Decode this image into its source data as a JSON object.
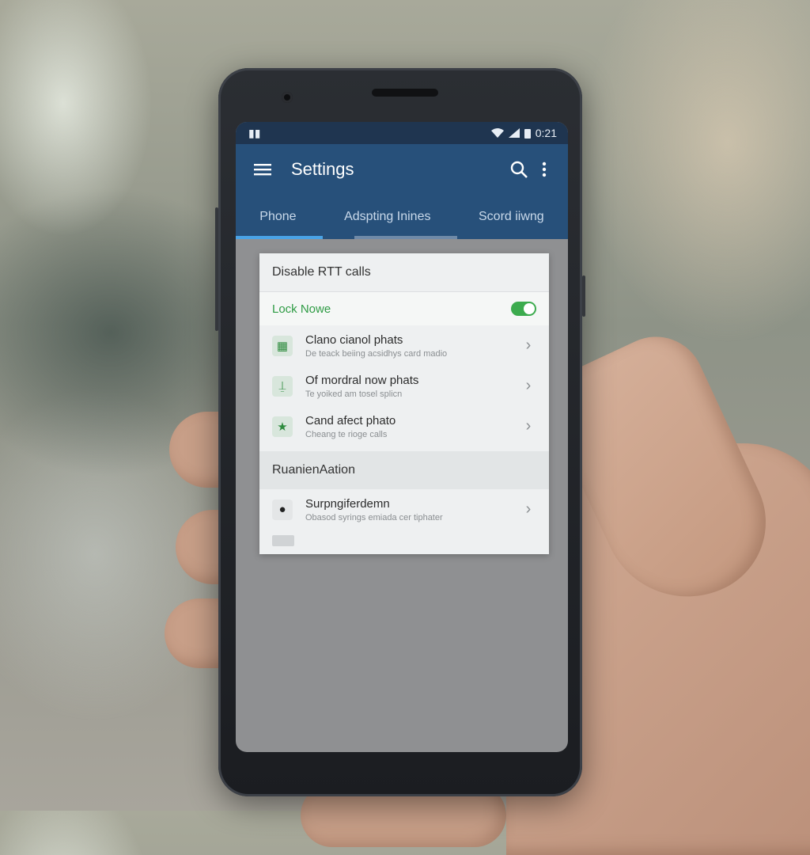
{
  "status_bar": {
    "left_glyph": "▮▮",
    "time": "0:21",
    "icons": [
      "wifi-icon",
      "signal-icon",
      "battery-icon"
    ]
  },
  "app_bar": {
    "title": "Settings",
    "icons": [
      "hamburger-menu-icon",
      "search-icon",
      "more-vert-icon"
    ]
  },
  "tabs": [
    {
      "label": "Phone"
    },
    {
      "label": "Adspting Inines"
    },
    {
      "label": "Scord iiwng"
    }
  ],
  "card": {
    "header": "Disable RTT calls",
    "toggle_row": {
      "label": "Lock Nowe",
      "on": true
    },
    "items": [
      {
        "title": "Clano cianol phats",
        "subtitle": "De teack beiing acsidhys card madio",
        "icon": "grid-icon"
      },
      {
        "title": "Of mordral now phats",
        "subtitle": "Te yoiked am tosel splicn",
        "icon": "person-icon"
      },
      {
        "title": "Cand afect phato",
        "subtitle": "Cheang te rioge calls",
        "icon": "star-icon"
      }
    ],
    "section_title": "RuanienAation",
    "section_item": {
      "title": "Surpngiferdemn",
      "subtitle": "Obasod syrings emiada cer tiphater",
      "icon": "dot-icon"
    }
  },
  "colors": {
    "app_bar": "#27507a",
    "status_bar": "#1f3550",
    "accent_green": "#3cab4e"
  }
}
